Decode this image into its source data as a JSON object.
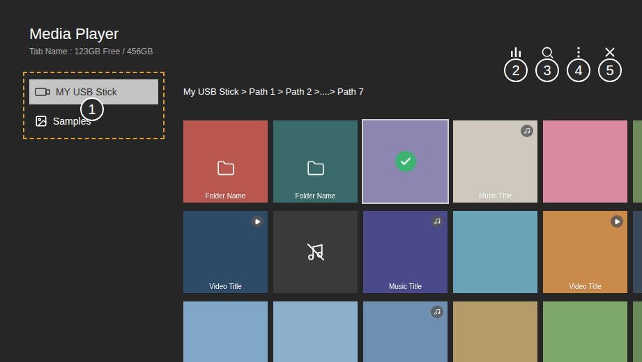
{
  "window": {
    "title": "Media Player",
    "subtitle": "Tab Name : 123GB Free / 456GB"
  },
  "sidebar": {
    "items": [
      {
        "label": "MY USB Stick",
        "kind": "usb",
        "selected": true
      },
      {
        "label": "Samples",
        "kind": "samples",
        "selected": false
      }
    ]
  },
  "breadcrumb": "My USB Stick > Path 1 > Path 2 >....> Path 7",
  "callouts": [
    "1",
    "2",
    "3",
    "4",
    "5"
  ],
  "tiles": [
    {
      "kind": "folder",
      "title": "Folder Name",
      "selected": false,
      "color": "#b8584e"
    },
    {
      "kind": "folder",
      "title": "Folder Name",
      "selected": false,
      "color": "#3b6a6a"
    },
    {
      "kind": "image",
      "title": "",
      "selected": true,
      "color": "#8c86b0"
    },
    {
      "kind": "music",
      "title": "Music Title",
      "selected": false,
      "color": "#cfc8bd"
    },
    {
      "kind": "image",
      "title": "",
      "selected": false,
      "color": "#d98aa0"
    },
    {
      "kind": "image",
      "title": "",
      "selected": false,
      "color": "#6f8a5a"
    },
    {
      "kind": "video",
      "title": "Video Title",
      "selected": false,
      "color": "#2d4a66"
    },
    {
      "kind": "broken",
      "title": "",
      "selected": false,
      "color": "#3a3a3a"
    },
    {
      "kind": "music",
      "title": "Music Title",
      "selected": false,
      "color": "#4a4a8a"
    },
    {
      "kind": "image",
      "title": "",
      "selected": false,
      "color": "#6aa3b8"
    },
    {
      "kind": "video",
      "title": "Video Title",
      "selected": false,
      "color": "#c98a4a"
    },
    {
      "kind": "image",
      "title": "",
      "selected": false,
      "color": "#3a4a5a"
    },
    {
      "kind": "image",
      "title": "",
      "selected": false,
      "color": "#7fa8c8"
    },
    {
      "kind": "image",
      "title": "",
      "selected": false,
      "color": "#8cb0cc"
    },
    {
      "kind": "music",
      "title": "",
      "selected": false,
      "color": "#6f8fb0"
    },
    {
      "kind": "image",
      "title": "",
      "selected": false,
      "color": "#b59a6a"
    },
    {
      "kind": "image",
      "title": "",
      "selected": false,
      "color": "#7ea86a"
    },
    {
      "kind": "image",
      "title": "",
      "selected": false,
      "color": "#6a8a5a"
    }
  ]
}
